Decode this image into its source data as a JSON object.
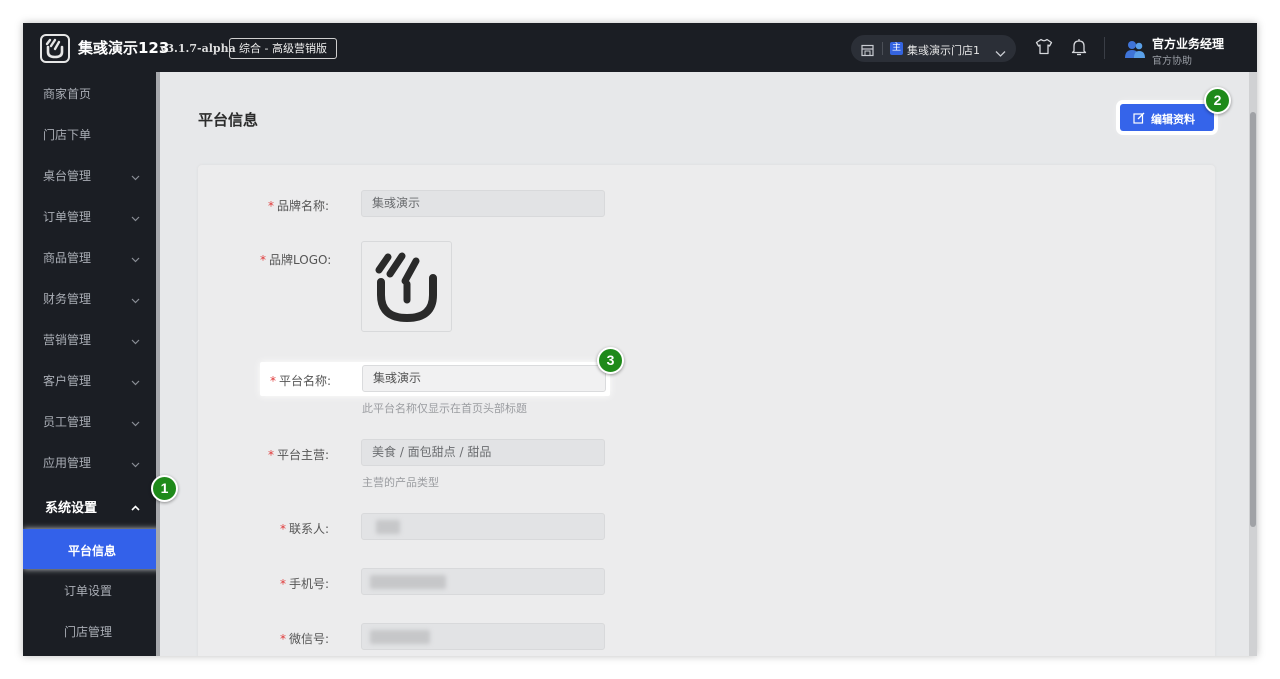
{
  "header": {
    "app_name": "集彧演示123",
    "version": "v3.1.7-alpha",
    "edition": "综合 - 高级营销版",
    "store_badge": "主",
    "store_name": "集彧演示门店1",
    "user_name": "官方业务经理",
    "user_role": "官方协助"
  },
  "sidebar": {
    "items": [
      {
        "label": "商家首页"
      },
      {
        "label": "门店下单"
      },
      {
        "label": "桌台管理"
      },
      {
        "label": "订单管理"
      },
      {
        "label": "商品管理"
      },
      {
        "label": "财务管理"
      },
      {
        "label": "营销管理"
      },
      {
        "label": "客户管理"
      },
      {
        "label": "员工管理"
      },
      {
        "label": "应用管理"
      },
      {
        "label": "系统设置"
      }
    ],
    "sub_items": [
      {
        "label": "平台信息"
      },
      {
        "label": "订单设置"
      },
      {
        "label": "门店管理"
      }
    ]
  },
  "page": {
    "title": "平台信息",
    "edit_button": "编辑资料"
  },
  "form": {
    "brand_name_label": "品牌名称:",
    "brand_name_value": "集彧演示",
    "brand_logo_label": "品牌LOGO:",
    "platform_name_label": "平台名称:",
    "platform_name_value": "集彧演示",
    "platform_name_hint": "此平台名称仅显示在首页头部标题",
    "category_label": "平台主营:",
    "category_value": "美食 / 面包甜点 / 甜品",
    "category_hint": "主营的产品类型",
    "contact_label": "联系人:",
    "phone_label": "手机号:",
    "wechat_label": "微信号:",
    "required_mark": "*"
  },
  "badges": {
    "one": "1",
    "two": "2",
    "three": "3"
  },
  "colors": {
    "accent": "#3564ea",
    "topbar": "#1b1e24",
    "badge": "#1f8a1a",
    "required": "#e03a3a"
  }
}
